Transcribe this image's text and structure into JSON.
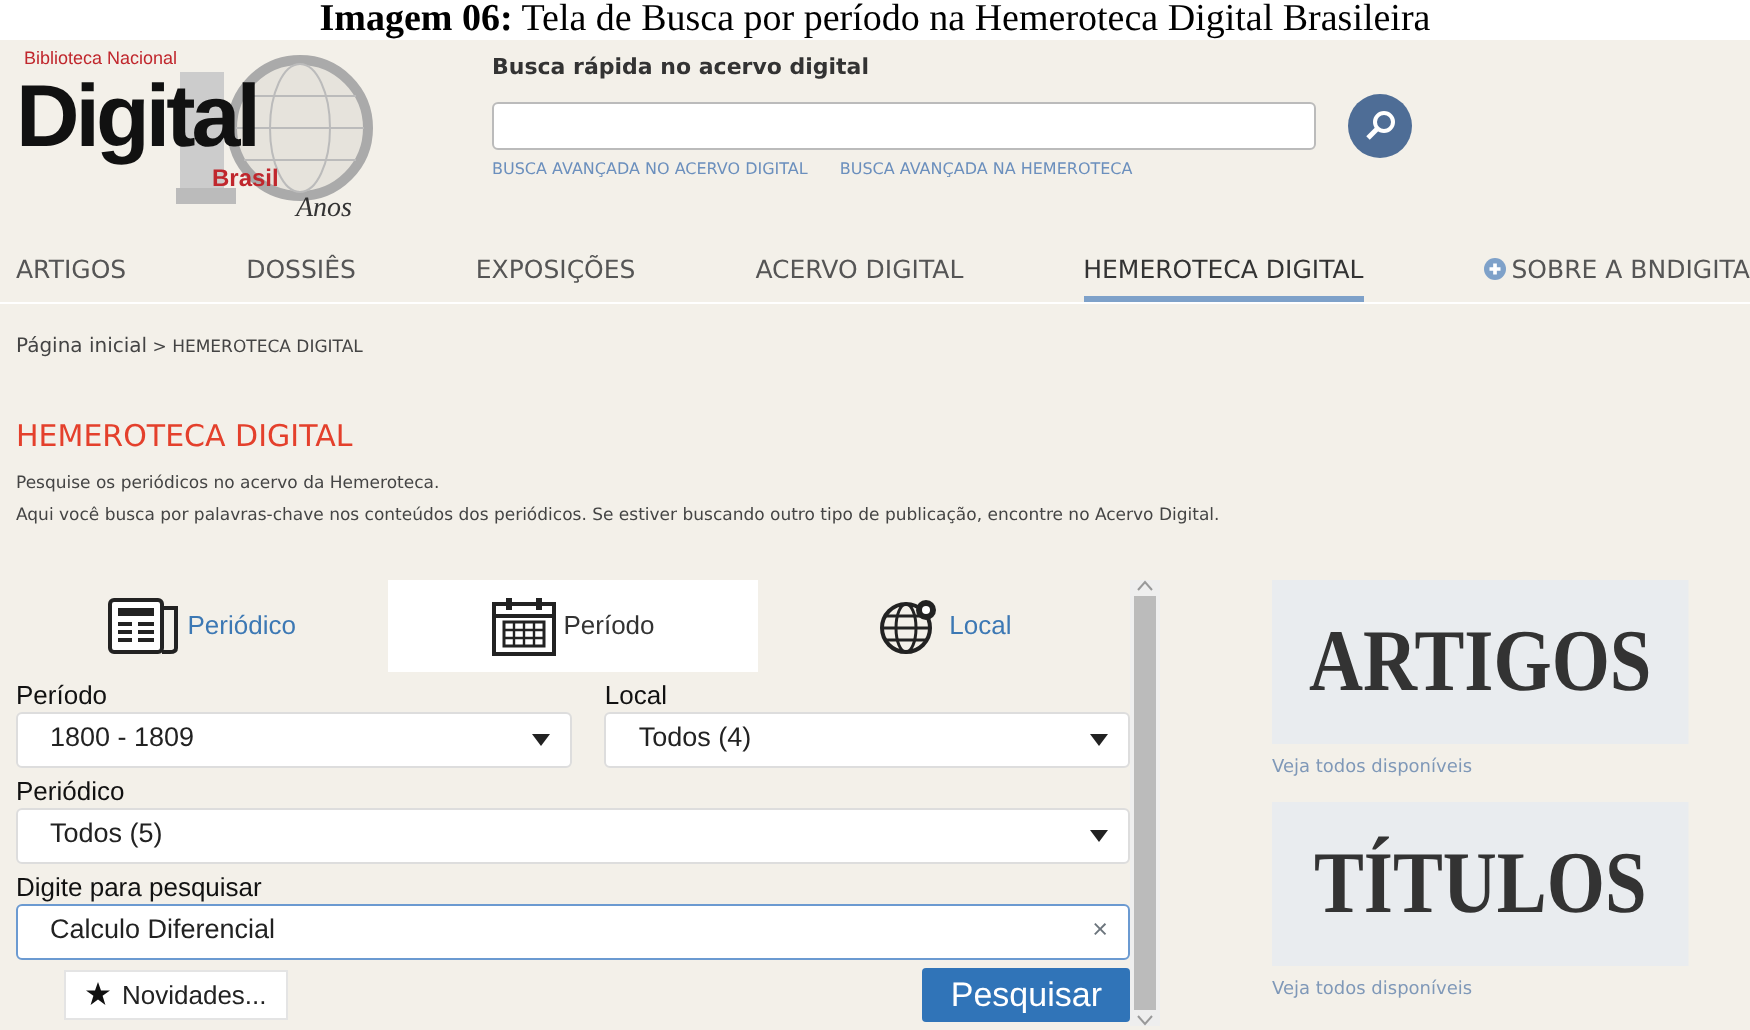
{
  "caption": "**Imagem 06:** Tela de Busca por período na Hemeroteca Digital Brasileira",
  "logo": {
    "top": "Biblioteca Nacional",
    "main": "Digital",
    "sub": "Brasil",
    "years": "Anos"
  },
  "quick_search": {
    "label": "Busca rápida no acervo digital",
    "links": [
      "BUSCA AVANÇADA NO ACERVO DIGITAL",
      "BUSCA AVANÇADA NA HEMEROTECA"
    ]
  },
  "nav": [
    {
      "label": "ARTIGOS",
      "selected": false,
      "kind": "plain"
    },
    {
      "label": "DOSSIÊS",
      "selected": false,
      "kind": "plain"
    },
    {
      "label": "EXPOSIÇÕES",
      "selected": false,
      "kind": "plain"
    },
    {
      "label": "ACERVO DIGITAL",
      "selected": false,
      "kind": "plain"
    },
    {
      "label": "HEMEROTECA DIGITAL",
      "selected": true,
      "kind": "plain"
    },
    {
      "label": "SOBRE A BNDIGITA",
      "selected": false,
      "kind": "plus"
    }
  ],
  "breadcrumb": {
    "home": "Página inicial",
    "separator": ">",
    "current": "HEMEROTECA DIGITAL"
  },
  "heading": "HEMEROTECA DIGITAL",
  "intro": {
    "line_1": "Pesquise os periódicos no acervo da Hemeroteca.",
    "line_2": "Aqui você busca por palavras-chave nos conteúdos dos periódicos. Se estiver buscando outro tipo de publicação, encontre no",
    "link": "Acervo Digital",
    "end": "."
  },
  "tabs": [
    {
      "label": "Periódico",
      "kind": "newspaper",
      "selected": false
    },
    {
      "label": "Período",
      "kind": "calendar",
      "selected": true
    },
    {
      "label": "Local",
      "kind": "globe",
      "selected": false
    }
  ],
  "form": {
    "period": {
      "label": "Período",
      "value": "1800 - 1809"
    },
    "place": {
      "label": "Local",
      "value": "Todos (4)"
    },
    "periodical": {
      "label": "Periódico",
      "value": "Todos (5)"
    },
    "search": {
      "label": "Digite para pesquisar",
      "value": "Calculo Diferencial",
      "clear": "×"
    },
    "news_button": "Novidades...",
    "search_button": "Pesquisar"
  },
  "banners": [
    {
      "title": "ARTIGOS",
      "link": "Veja todos disponíveis"
    },
    {
      "title": "TÍTULOS",
      "link": "Veja todos disponíveis"
    }
  ]
}
